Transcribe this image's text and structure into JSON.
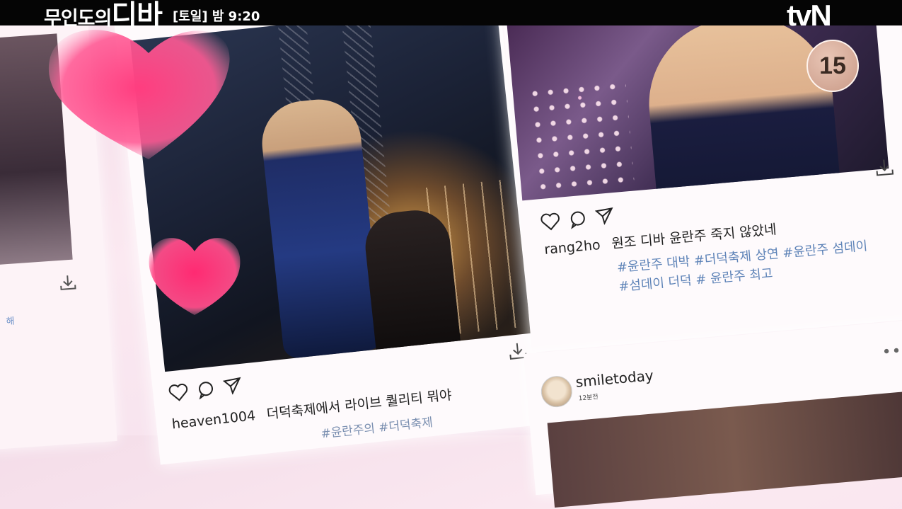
{
  "broadcast": {
    "show_title_small": "무인도의",
    "show_title_big": "디바",
    "airtime": "[토일] 밤 9:20",
    "channel_logo": "tvN",
    "age_rating": "15"
  },
  "posts": [
    {
      "username": "heaven1004",
      "caption": "더덕축제에서 라이브 퀄리티 뭐야",
      "tags_fragment": "#윤란주의 #더덕축제",
      "icons": [
        "heart-icon",
        "comment-icon",
        "share-icon",
        "download-icon"
      ]
    },
    {
      "username": "rang2ho",
      "caption": "원조 디바 윤란주 죽지 않았네",
      "tags_line1": "#윤란주 대박 #더덕축제 상연 #윤란주 섬데이",
      "tags_line2": "#섬데이 더덕 # 윤란주 최고",
      "icons": [
        "heart-icon",
        "comment-icon",
        "share-icon",
        "download-icon"
      ]
    },
    {
      "username": "smiletoday",
      "time": "12분전",
      "menu": "•••"
    }
  ],
  "left_partial": {
    "fragment": "해"
  },
  "colors": {
    "heart_pink": "#f0508a",
    "tag_blue": "#5f84b8",
    "background_pink": "#f7e3ee"
  }
}
